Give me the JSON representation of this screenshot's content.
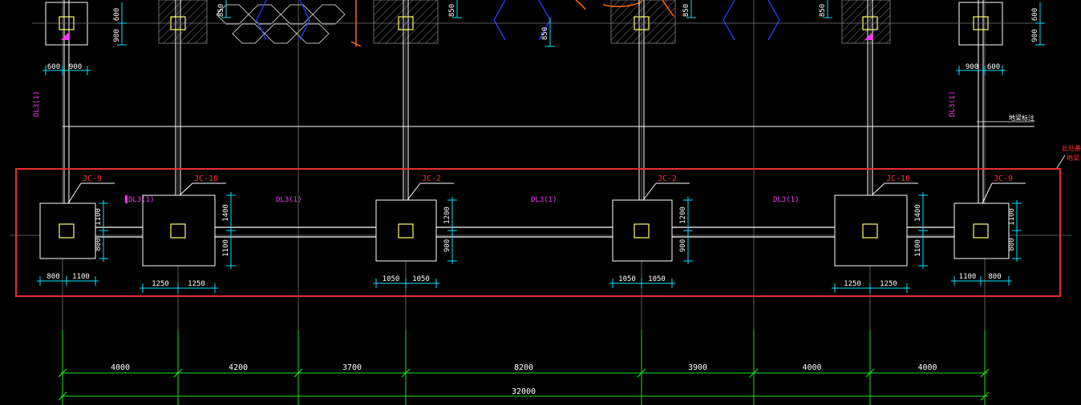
{
  "colors": {
    "background": "#000000",
    "line": "#ffffff",
    "dim": "#00e5ff",
    "grid": "#19e019",
    "label": "#ff3030",
    "beam": "#ff33ff",
    "column": "#ffff66",
    "hatch": "#6a6a6a",
    "highlight": "#e82d2d",
    "accent": "#ff6a00",
    "blue": "#2a3cff"
  },
  "drawing": {
    "footing_labels": [
      "JC-9",
      "JC-10",
      "JC-2",
      "JC-2",
      "JC-10",
      "JC-9"
    ],
    "beam_labels": [
      "DL3(1)",
      "DL3(1)",
      "DL3(1)",
      "DL3(1)",
      "DL3(1)",
      "DL3(1)"
    ],
    "footing_dims_vertical": [
      [
        "1100",
        "800"
      ],
      [
        "1400",
        "1100"
      ],
      [
        "1200",
        "900"
      ],
      [
        "1200",
        "900"
      ],
      [
        "1400",
        "1100"
      ],
      [
        "1100",
        "800"
      ]
    ],
    "footing_dims_horizontal": [
      [
        "800",
        "1100"
      ],
      [
        "1250",
        "1250"
      ],
      [
        "1050",
        "1050"
      ],
      [
        "1050",
        "1050"
      ],
      [
        "1250",
        "1250"
      ],
      [
        "1100",
        "800"
      ]
    ],
    "top_dims": [
      "600",
      "900",
      "850",
      "850",
      "850",
      "850",
      "850",
      "600",
      "900"
    ],
    "top_bottom_dims": [
      "600",
      "900",
      "900",
      "600"
    ],
    "axis_spacings": [
      "4000",
      "4200",
      "3700",
      "8200",
      "3900",
      "4000",
      "4000"
    ],
    "total_span": "32000",
    "note_label": "地梁标注",
    "corner_note": [
      "此处基础",
      "地梁"
    ]
  }
}
